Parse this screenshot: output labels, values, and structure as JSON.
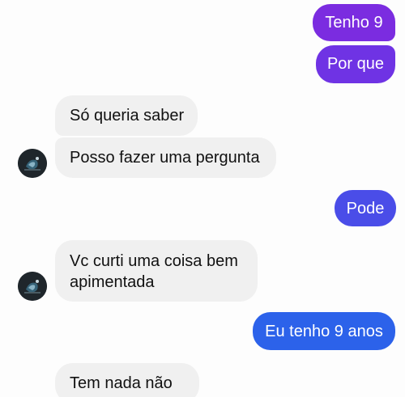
{
  "colors": {
    "sent_gradient_purple": "#7b2ce0",
    "sent_gradient_violet": "#6a35e6",
    "sent_gradient_indigo": "#4a4de8",
    "sent_gradient_blue": "#2c62ea",
    "received_bubble": "#f0f0f0",
    "received_text": "#111111",
    "sent_text": "#ffffff"
  },
  "messages": [
    {
      "id": "tenho9",
      "direction": "sent",
      "text": "Tenho 9"
    },
    {
      "id": "porque",
      "direction": "sent",
      "text": "Por que"
    },
    {
      "id": "soqueria",
      "direction": "received",
      "text": "Só queria saber"
    },
    {
      "id": "posso",
      "direction": "received",
      "text": "Posso fazer uma pergunta"
    },
    {
      "id": "pode",
      "direction": "sent",
      "text": "Pode"
    },
    {
      "id": "vc",
      "direction": "received",
      "text": "Vc curti uma coisa bem apimentada"
    },
    {
      "id": "eutenho",
      "direction": "sent",
      "text": "Eu tenho 9 anos"
    },
    {
      "id": "temnada",
      "direction": "received",
      "text": "Tem nada não"
    }
  ],
  "avatar": {
    "icon": "contact-avatar-icon"
  }
}
